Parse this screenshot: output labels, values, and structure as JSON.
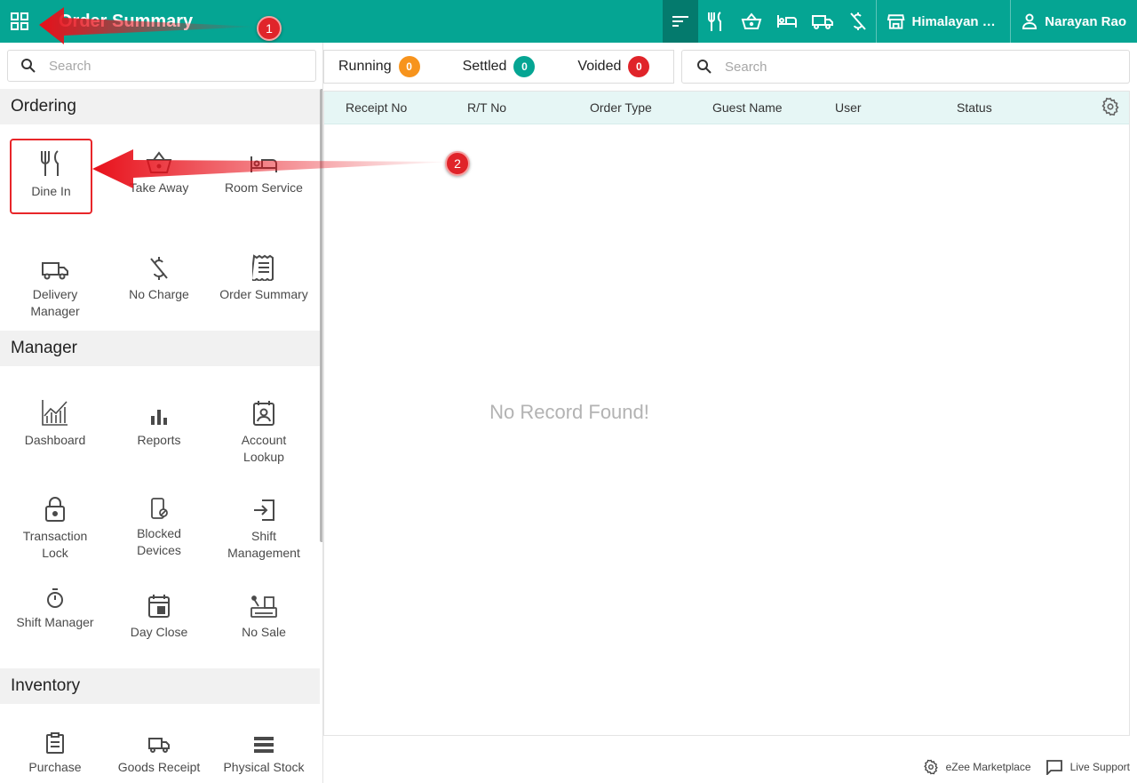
{
  "header": {
    "title": "Order Summary",
    "outlet_name": "Himalayan K...",
    "user_name": "Narayan Rao",
    "icons": [
      "sort-icon",
      "dine-in-icon",
      "take-away-icon",
      "room-service-icon",
      "delivery-icon",
      "no-charge-icon"
    ]
  },
  "sidebar": {
    "search_placeholder": "Search",
    "sections": {
      "ordering": {
        "title": "Ordering",
        "items": [
          "Dine In",
          "Take Away",
          "Room Service",
          "Delivery Manager",
          "No Charge",
          "Order Summary"
        ]
      },
      "manager": {
        "title": "Manager",
        "items": [
          "Dashboard",
          "Reports",
          "Account Lookup",
          "Transaction Lock",
          "Blocked Devices",
          "Shift Management",
          "Shift Manager",
          "Day Close",
          "No Sale"
        ]
      },
      "inventory": {
        "title": "Inventory",
        "items": [
          "Purchase",
          "Goods Receipt",
          "Physical Stock"
        ]
      }
    },
    "selected_item": "Dine In"
  },
  "status_tabs": [
    {
      "label": "Running",
      "count": "0",
      "color": "#f7941d"
    },
    {
      "label": "Settled",
      "count": "0",
      "color": "#05a593"
    },
    {
      "label": "Voided",
      "count": "0",
      "color": "#e0242a"
    }
  ],
  "main_search_placeholder": "Search",
  "table": {
    "columns": [
      "Receipt No",
      "R/T No",
      "Order Type",
      "Guest Name",
      "User",
      "Status"
    ],
    "empty_message": "No Record Found!"
  },
  "footer": {
    "marketplace": "eZee Marketplace",
    "support": "Live Support"
  },
  "annotations": [
    "1",
    "2"
  ],
  "colors": {
    "brand": "#05a593",
    "brand_dark": "#047a6d",
    "highlight": "#e8262a"
  }
}
